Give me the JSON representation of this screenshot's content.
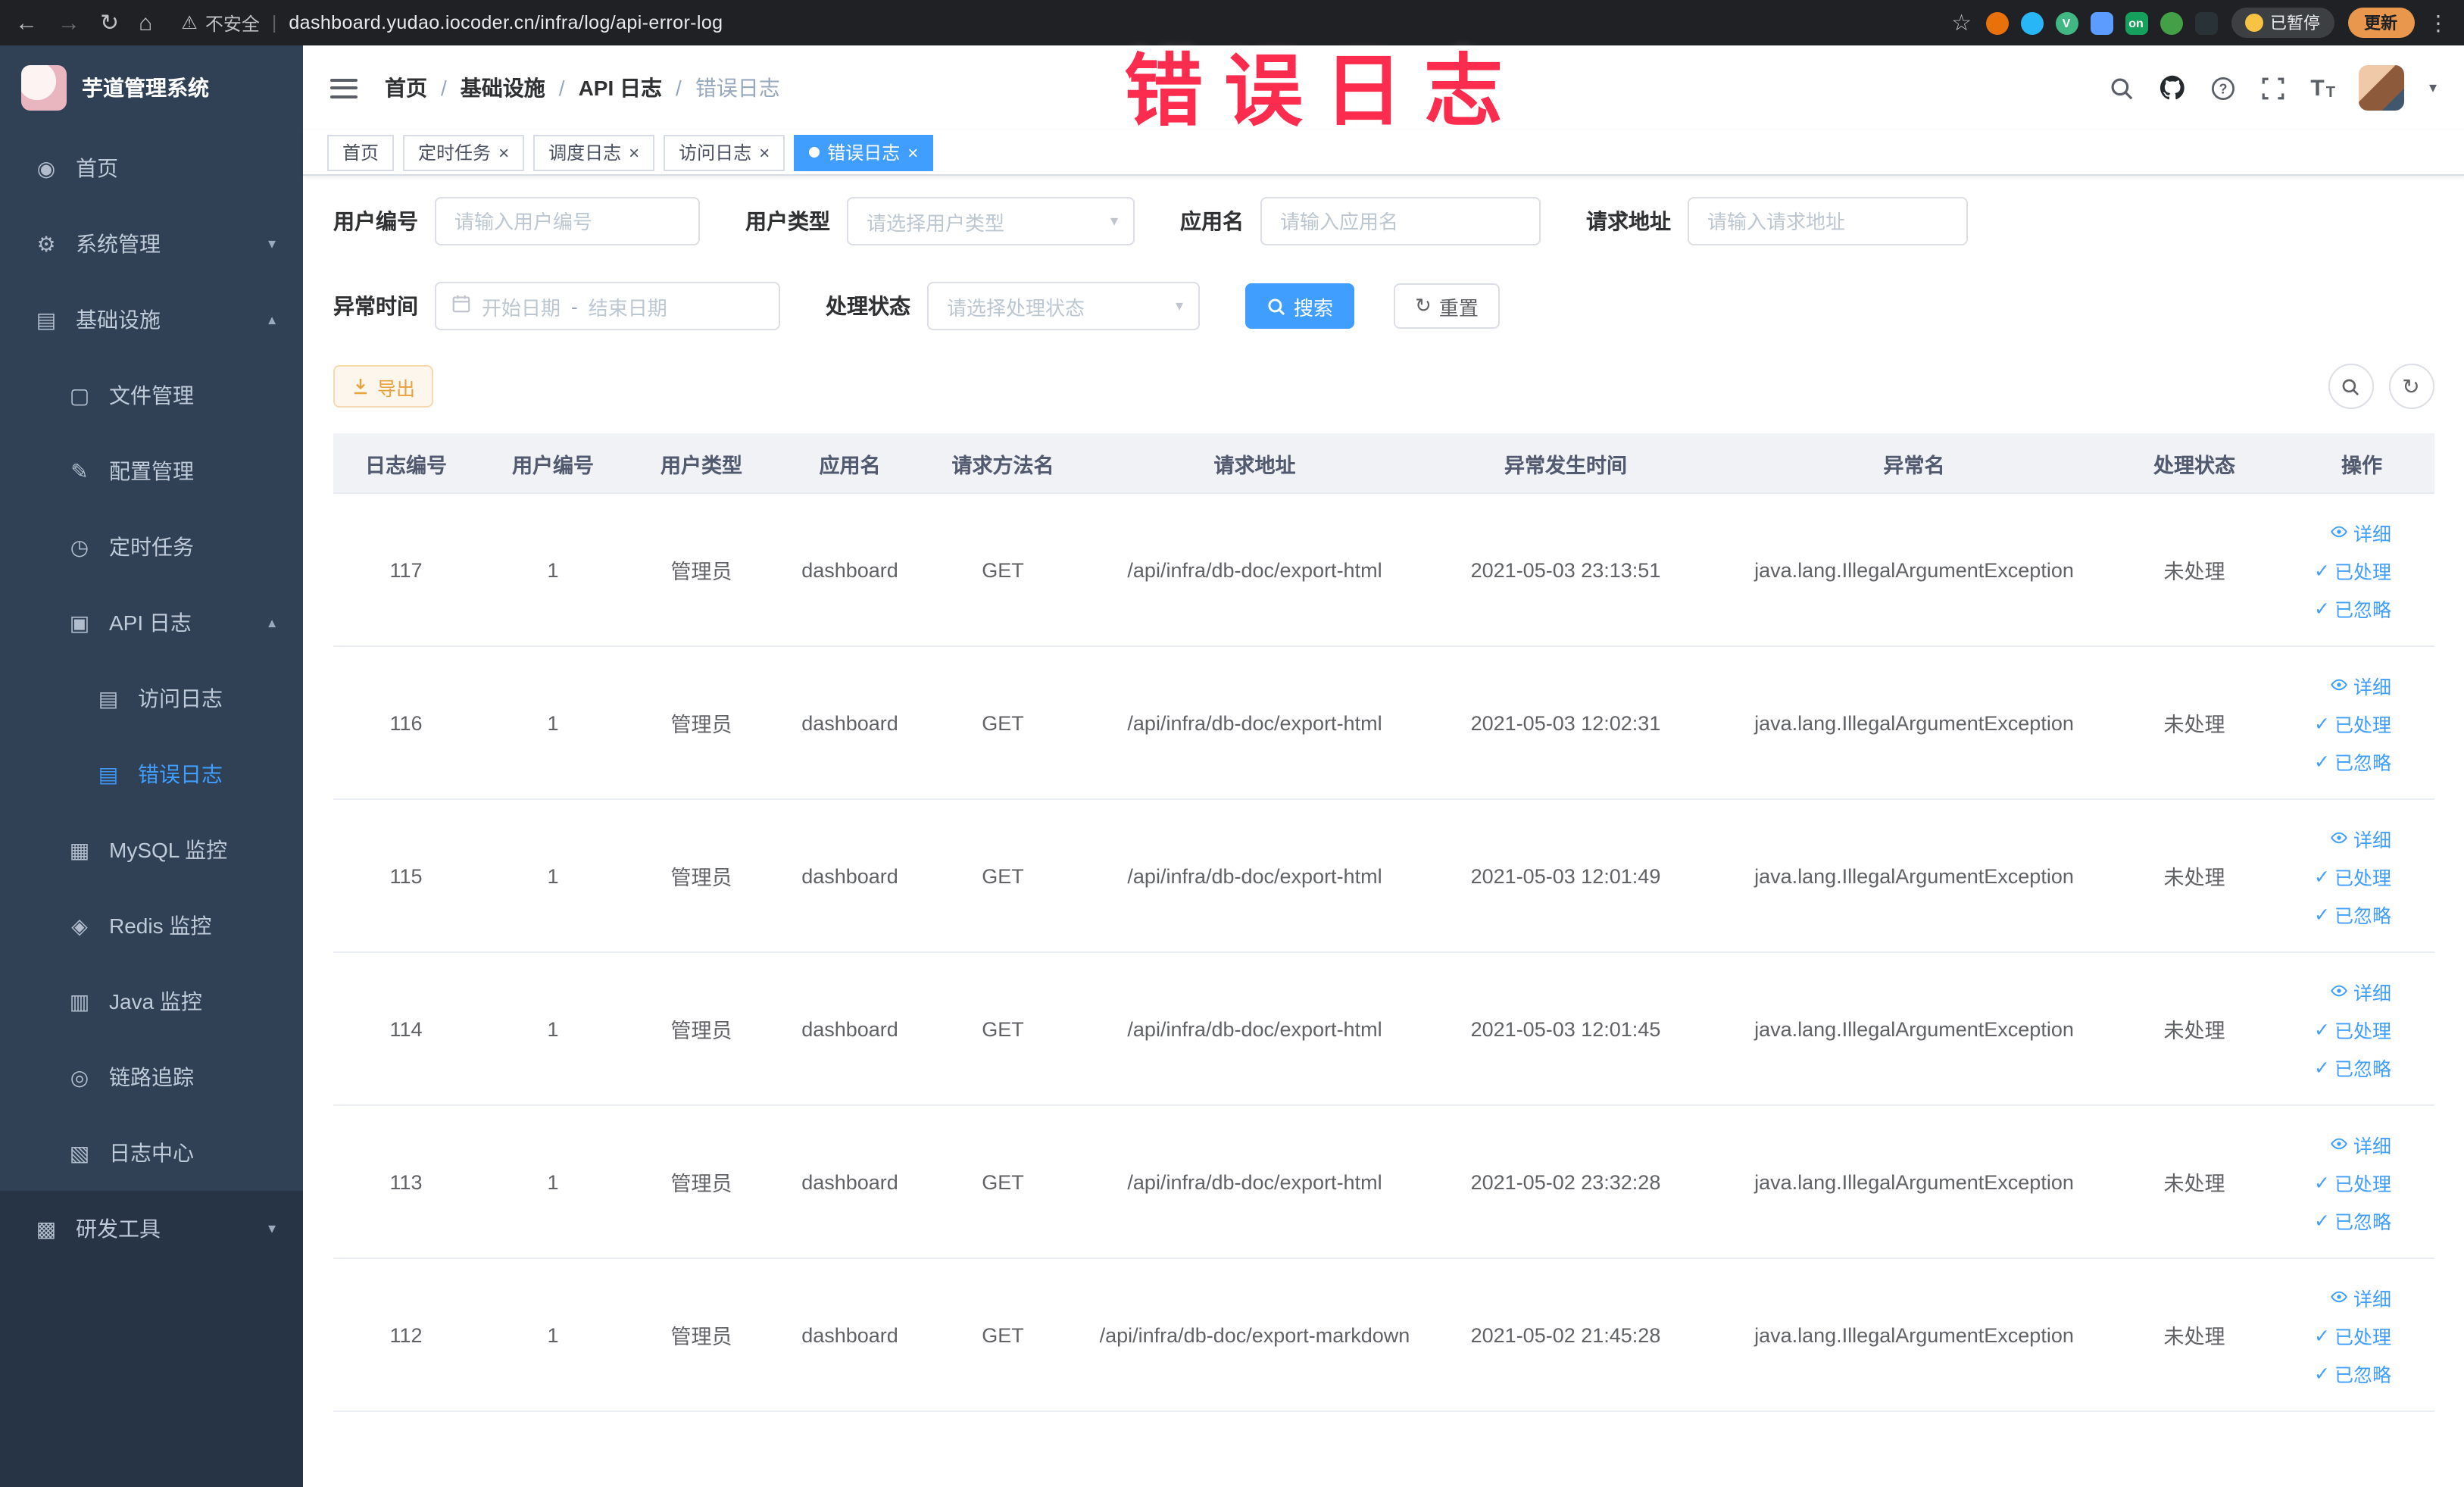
{
  "browser": {
    "security_label": "不安全",
    "url": "dashboard.yudao.iocoder.cn/infra/log/api-error-log",
    "paused_badge": "已暂停",
    "update_button": "更新",
    "extensions": [
      {
        "name": "extension-orange-icon",
        "color": "#e8710a",
        "letter": "",
        "round": true
      },
      {
        "name": "extension-water-icon",
        "color": "#29b6f6",
        "letter": "",
        "round": true
      },
      {
        "name": "vue-devtools-icon",
        "color": "#41b883",
        "letter": "V",
        "round": true
      },
      {
        "name": "extension-grid-icon",
        "color": "#5c9cff",
        "letter": "",
        "round": false
      },
      {
        "name": "proxy-on-icon",
        "color": "#16a05d",
        "letter": "on",
        "round": false
      },
      {
        "name": "extension-leaf-icon",
        "color": "#43a047",
        "letter": "",
        "round": true
      },
      {
        "name": "tampermonkey-icon",
        "color": "#283237",
        "letter": "",
        "round": false
      }
    ]
  },
  "annotation": {
    "text": "错误日志",
    "color": "#fb2c4d"
  },
  "sidebar": {
    "logo_title": "芋道管理系统",
    "items": [
      {
        "id": "home",
        "label": "首页",
        "icon": "dashboard-icon",
        "glyph": "◉",
        "level": 1
      },
      {
        "id": "system-management",
        "label": "系统管理",
        "icon": "gear-icon",
        "glyph": "⚙",
        "level": 1,
        "chevron": "down"
      },
      {
        "id": "infrastructure",
        "label": "基础设施",
        "icon": "infrastructure-icon",
        "glyph": "▤",
        "level": 1,
        "chevron": "up"
      },
      {
        "id": "file-management",
        "label": "文件管理",
        "icon": "file-icon",
        "glyph": "▢",
        "level": 2
      },
      {
        "id": "config-management",
        "label": "配置管理",
        "icon": "config-icon",
        "glyph": "✎",
        "level": 2
      },
      {
        "id": "scheduled-tasks",
        "label": "定时任务",
        "icon": "timer-icon",
        "glyph": "◷",
        "level": 2
      },
      {
        "id": "api-log",
        "label": "API 日志",
        "icon": "api-log-icon",
        "glyph": "▣",
        "level": 2,
        "chevron": "up"
      },
      {
        "id": "access-log",
        "label": "访问日志",
        "icon": "access-log-icon",
        "glyph": "▤",
        "level": 3
      },
      {
        "id": "error-log",
        "label": "错误日志",
        "icon": "error-log-icon",
        "glyph": "▤",
        "level": 3,
        "active": true
      },
      {
        "id": "mysql-monitor",
        "label": "MySQL 监控",
        "icon": "mysql-icon",
        "glyph": "▦",
        "level": 2
      },
      {
        "id": "redis-monitor",
        "label": "Redis 监控",
        "icon": "redis-icon",
        "glyph": "◈",
        "level": 2
      },
      {
        "id": "java-monitor",
        "label": "Java 监控",
        "icon": "java-icon",
        "glyph": "▥",
        "level": 2
      },
      {
        "id": "link-tracing",
        "label": "链路追踪",
        "icon": "trace-icon",
        "glyph": "◎",
        "level": 2
      },
      {
        "id": "log-center",
        "label": "日志中心",
        "icon": "log-center-icon",
        "glyph": "▧",
        "level": 2
      },
      {
        "id": "dev-tools",
        "label": "研发工具",
        "icon": "dev-tools-icon",
        "glyph": "▩",
        "level": 1,
        "chevron": "down",
        "dark": true
      }
    ]
  },
  "header": {
    "breadcrumb": [
      "首页",
      "基础设施",
      "API 日志",
      "错误日志"
    ]
  },
  "tabs": [
    {
      "label": "首页",
      "closable": false,
      "active": false
    },
    {
      "label": "定时任务",
      "closable": true,
      "active": false
    },
    {
      "label": "调度日志",
      "closable": true,
      "active": false
    },
    {
      "label": "访问日志",
      "closable": true,
      "active": false
    },
    {
      "label": "错误日志",
      "closable": true,
      "active": true
    }
  ],
  "filters": {
    "user_id_label": "用户编号",
    "user_id_placeholder": "请输入用户编号",
    "user_type_label": "用户类型",
    "user_type_placeholder": "请选择用户类型",
    "app_name_label": "应用名",
    "app_name_placeholder": "请输入应用名",
    "request_url_label": "请求地址",
    "request_url_placeholder": "请输入请求地址",
    "exception_time_label": "异常时间",
    "start_date_placeholder": "开始日期",
    "range_separator": "-",
    "end_date_placeholder": "结束日期",
    "process_status_label": "处理状态",
    "process_status_placeholder": "请选择处理状态",
    "search_label": "搜索",
    "reset_label": "重置"
  },
  "toolbar": {
    "export_label": "导出"
  },
  "table": {
    "columns": [
      "日志编号",
      "用户编号",
      "用户类型",
      "应用名",
      "请求方法名",
      "请求地址",
      "异常发生时间",
      "异常名",
      "处理状态",
      "操作"
    ],
    "actions": [
      {
        "name": "detail",
        "label": "详细",
        "icon": "eye-icon"
      },
      {
        "name": "mark-processed",
        "label": "已处理",
        "icon": "check-icon"
      },
      {
        "name": "mark-ignored",
        "label": "已忽略",
        "icon": "check-icon"
      }
    ],
    "rows": [
      {
        "log_id": "117",
        "user_id": "1",
        "user_type": "管理员",
        "app_name": "dashboard",
        "method": "GET",
        "url": "/api/infra/db-doc/export-html",
        "time": "2021-05-03 23:13:51",
        "exception": "java.lang.IllegalArgumentException",
        "status": "未处理"
      },
      {
        "log_id": "116",
        "user_id": "1",
        "user_type": "管理员",
        "app_name": "dashboard",
        "method": "GET",
        "url": "/api/infra/db-doc/export-html",
        "time": "2021-05-03 12:02:31",
        "exception": "java.lang.IllegalArgumentException",
        "status": "未处理"
      },
      {
        "log_id": "115",
        "user_id": "1",
        "user_type": "管理员",
        "app_name": "dashboard",
        "method": "GET",
        "url": "/api/infra/db-doc/export-html",
        "time": "2021-05-03 12:01:49",
        "exception": "java.lang.IllegalArgumentException",
        "status": "未处理"
      },
      {
        "log_id": "114",
        "user_id": "1",
        "user_type": "管理员",
        "app_name": "dashboard",
        "method": "GET",
        "url": "/api/infra/db-doc/export-html",
        "time": "2021-05-03 12:01:45",
        "exception": "java.lang.IllegalArgumentException",
        "status": "未处理"
      },
      {
        "log_id": "113",
        "user_id": "1",
        "user_type": "管理员",
        "app_name": "dashboard",
        "method": "GET",
        "url": "/api/infra/db-doc/export-html",
        "time": "2021-05-02 23:32:28",
        "exception": "java.lang.IllegalArgumentException",
        "status": "未处理"
      },
      {
        "log_id": "112",
        "user_id": "1",
        "user_type": "管理员",
        "app_name": "dashboard",
        "method": "GET",
        "url": "/api/infra/db-doc/export-markdown",
        "time": "2021-05-02 21:45:28",
        "exception": "java.lang.IllegalArgumentException",
        "status": "未处理"
      }
    ]
  }
}
